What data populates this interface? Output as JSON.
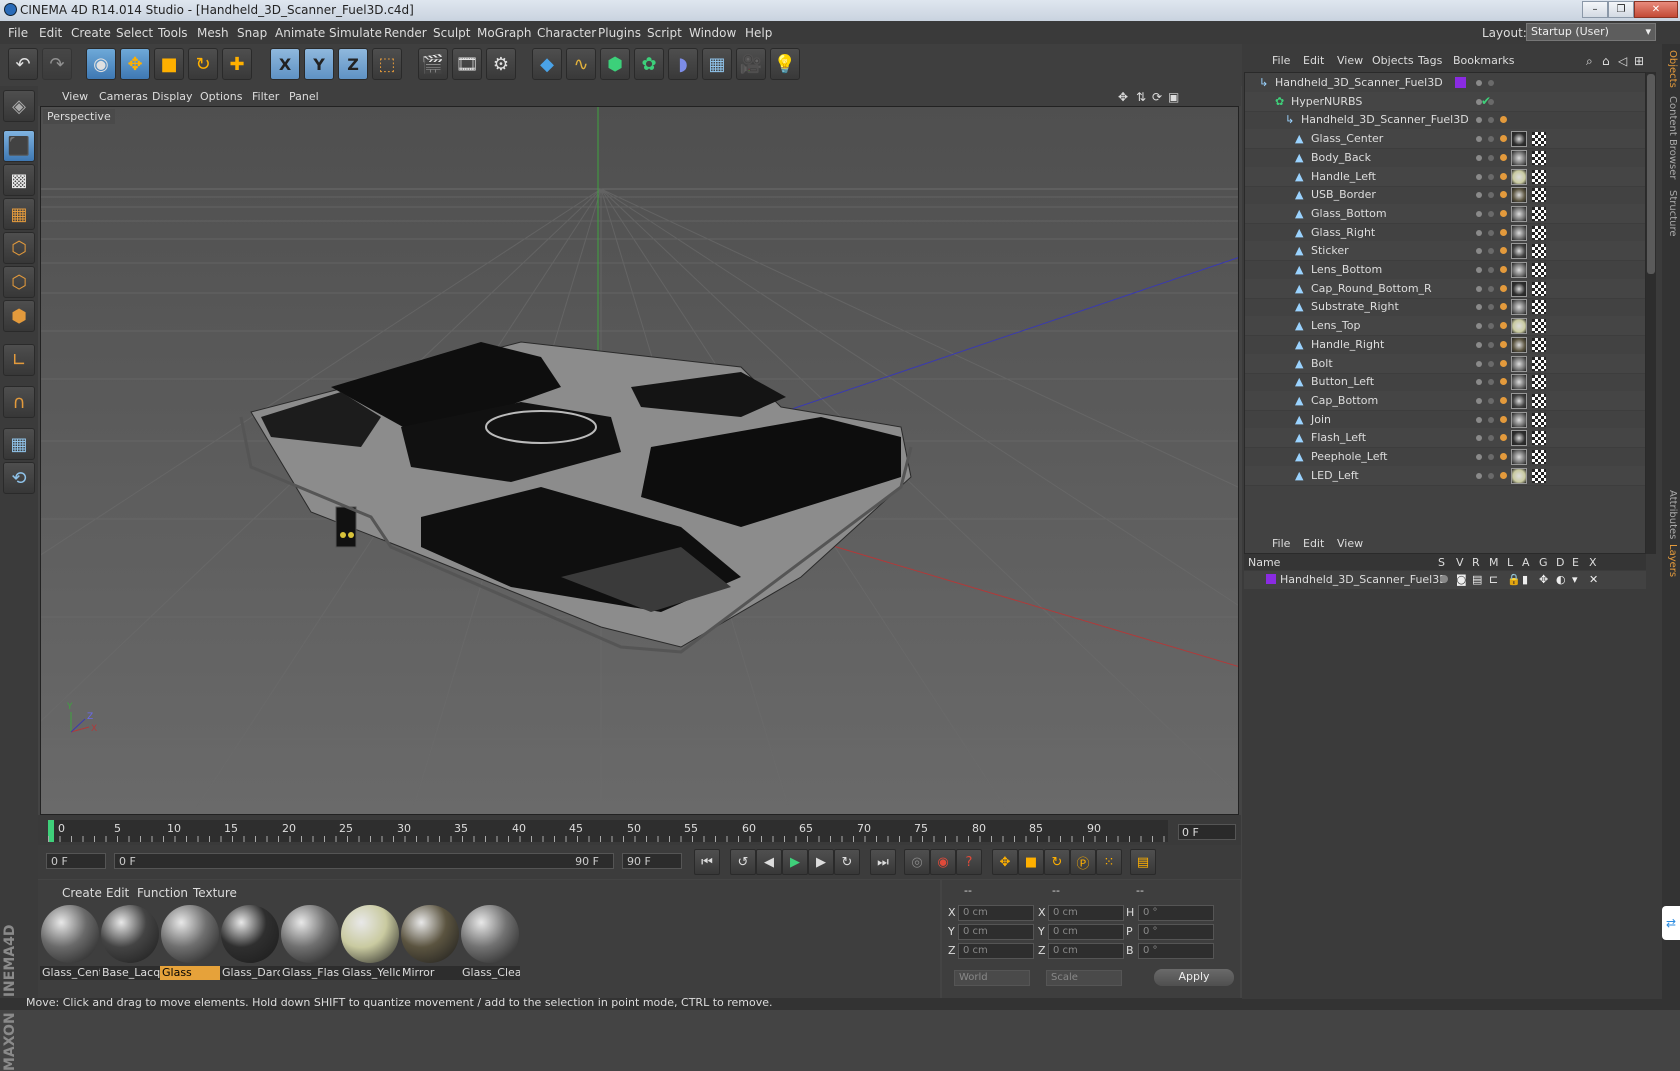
{
  "window": {
    "title": "CINEMA 4D R14.014 Studio - [Handheld_3D_Scanner_Fuel3D.c4d]",
    "minimize": "–",
    "restore": "❐",
    "close": "✕"
  },
  "menu": [
    "File",
    "Edit",
    "Create",
    "Select",
    "Tools",
    "Mesh",
    "Snap",
    "Animate",
    "Simulate",
    "Render",
    "Sculpt",
    "MoGraph",
    "Character",
    "Plugins",
    "Script",
    "Window",
    "Help"
  ],
  "layout": {
    "label": "Layout:",
    "value": "Startup (User)"
  },
  "toolbar_icons": [
    "undo-icon",
    "redo-icon",
    "live-select-icon",
    "move-icon",
    "scale-icon",
    "rotate-icon",
    "add-icon",
    "x-axis-icon",
    "y-axis-icon",
    "z-axis-icon",
    "coordinate-system-icon",
    "render-view-icon",
    "render-picture-viewer-icon",
    "render-settings-icon",
    "cube-icon",
    "spline-pen-icon",
    "subdivision-icon",
    "mograph-cloner-icon",
    "deformer-icon",
    "floor-icon",
    "camera-icon",
    "light-icon"
  ],
  "axis_labels": {
    "x": "X",
    "y": "Y",
    "z": "Z"
  },
  "viewport": {
    "menu": [
      "View",
      "Cameras",
      "Display",
      "Options",
      "Filter",
      "Panel"
    ],
    "label": "Perspective"
  },
  "timeline": {
    "ticks": [
      "0",
      "5",
      "10",
      "15",
      "20",
      "25",
      "30",
      "35",
      "40",
      "45",
      "50",
      "55",
      "60",
      "65",
      "70",
      "75",
      "80",
      "85",
      "90"
    ],
    "current_frame": "0 F",
    "start": "0 F",
    "range_start": "0 F",
    "range_end": "90 F",
    "end": "90 F"
  },
  "materials": {
    "menu": [
      "Create",
      "Edit",
      "Function",
      "Texture"
    ],
    "items": [
      {
        "name": "Glass_Cent",
        "color": "#6a6a6a"
      },
      {
        "name": "Base_Lacqu",
        "color": "#444444"
      },
      {
        "name": "Glass",
        "color": "#6f6f6f"
      },
      {
        "name": "Glass_Darc",
        "color": "#2f2f2f"
      },
      {
        "name": "Glass_Flash",
        "color": "#707070"
      },
      {
        "name": "Glass_Yello",
        "color": "#c9caa0"
      },
      {
        "name": "Mirror",
        "color": "#5b5440"
      },
      {
        "name": "Glass_Clear",
        "color": "#727272"
      }
    ],
    "selected_index": 2
  },
  "coords": {
    "headers": [
      "--",
      "--",
      "--"
    ],
    "rows": [
      {
        "a": "X",
        "av": "0 cm",
        "b": "X",
        "bv": "0 cm",
        "c": "H",
        "cv": "0 °"
      },
      {
        "a": "Y",
        "av": "0 cm",
        "b": "Y",
        "bv": "0 cm",
        "c": "P",
        "cv": "0 °"
      },
      {
        "a": "Z",
        "av": "0 cm",
        "b": "Z",
        "bv": "0 cm",
        "c": "B",
        "cv": "0 °"
      }
    ],
    "world": "World",
    "scale": "Scale",
    "apply": "Apply"
  },
  "status": "Move: Click and drag to move elements. Hold down SHIFT to quantize movement / add to the selection in point mode, CTRL to remove.",
  "objects": {
    "menu": [
      "File",
      "Edit",
      "View",
      "Objects",
      "Tags",
      "Bookmarks"
    ],
    "tree": [
      {
        "name": "Handheld_3D_Scanner_Fuel3D",
        "depth": 0,
        "icon": "null-object-icon"
      },
      {
        "name": "HyperNURBS",
        "depth": 1,
        "icon": "hypernurbs-icon"
      },
      {
        "name": "Handheld_3D_Scanner_Fuel3D",
        "depth": 2,
        "icon": "null-object-icon"
      },
      {
        "name": "Glass_Center",
        "depth": 3,
        "icon": "polygon-object-icon"
      },
      {
        "name": "Body_Back",
        "depth": 3,
        "icon": "polygon-object-icon"
      },
      {
        "name": "Handle_Left",
        "depth": 3,
        "icon": "polygon-object-icon"
      },
      {
        "name": "USB_Border",
        "depth": 3,
        "icon": "polygon-object-icon"
      },
      {
        "name": "Glass_Bottom",
        "depth": 3,
        "icon": "polygon-object-icon"
      },
      {
        "name": "Glass_Right",
        "depth": 3,
        "icon": "polygon-object-icon"
      },
      {
        "name": "Sticker",
        "depth": 3,
        "icon": "polygon-object-icon"
      },
      {
        "name": "Lens_Bottom",
        "depth": 3,
        "icon": "polygon-object-icon"
      },
      {
        "name": "Cap_Round_Bottom_R",
        "depth": 3,
        "icon": "polygon-object-icon"
      },
      {
        "name": "Substrate_Right",
        "depth": 3,
        "icon": "polygon-object-icon"
      },
      {
        "name": "Lens_Top",
        "depth": 3,
        "icon": "polygon-object-icon"
      },
      {
        "name": "Handle_Right",
        "depth": 3,
        "icon": "polygon-object-icon"
      },
      {
        "name": "Bolt",
        "depth": 3,
        "icon": "polygon-object-icon"
      },
      {
        "name": "Button_Left",
        "depth": 3,
        "icon": "polygon-object-icon"
      },
      {
        "name": "Cap_Bottom",
        "depth": 3,
        "icon": "polygon-object-icon"
      },
      {
        "name": "Join",
        "depth": 3,
        "icon": "polygon-object-icon"
      },
      {
        "name": "Flash_Left",
        "depth": 3,
        "icon": "polygon-object-icon"
      },
      {
        "name": "Peephole_Left",
        "depth": 3,
        "icon": "polygon-object-icon"
      },
      {
        "name": "LED_Left",
        "depth": 3,
        "icon": "polygon-object-icon"
      }
    ]
  },
  "layers": {
    "menu": [
      "File",
      "Edit",
      "View"
    ],
    "headers": [
      "Name",
      "S",
      "V",
      "R",
      "M",
      "L",
      "A",
      "G",
      "D",
      "E",
      "X"
    ],
    "row": "Handheld_3D_Scanner_Fuel3D",
    "row_color": "#8a2be2"
  },
  "side_tabs": [
    "Objects",
    "Content Browser",
    "Structure",
    "Attributes",
    "Layers"
  ]
}
